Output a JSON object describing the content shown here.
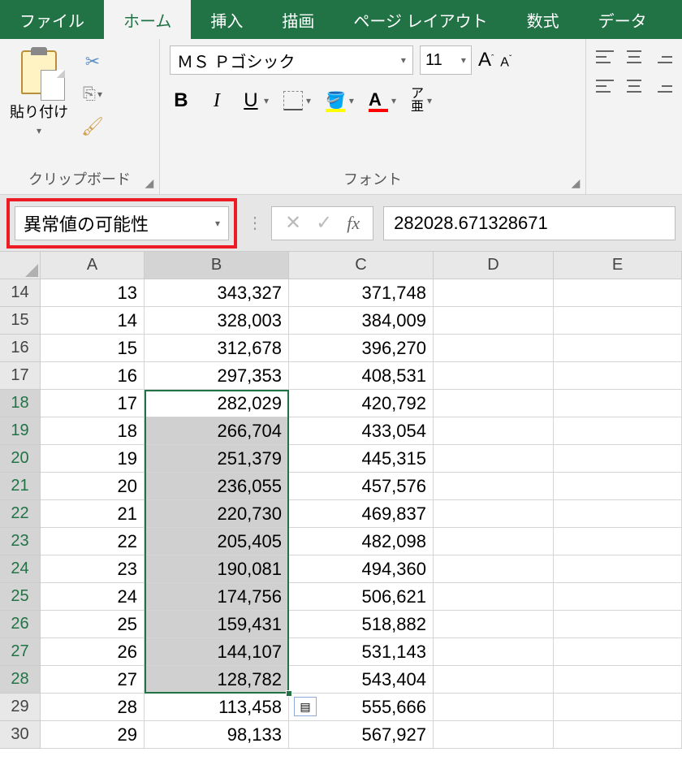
{
  "tabs": {
    "file": "ファイル",
    "home": "ホーム",
    "insert": "挿入",
    "draw": "描画",
    "pagelayout": "ページ レイアウト",
    "formulas": "数式",
    "data": "データ"
  },
  "ribbon": {
    "clipboard": {
      "paste_label": "貼り付け",
      "group_label": "クリップボード"
    },
    "font": {
      "name": "ＭＳ Ｐゴシック",
      "size": "11",
      "group_label": "フォント",
      "bold": "B",
      "italic": "I",
      "underline": "U",
      "ruby_top": "ア",
      "ruby_bot": "亜"
    }
  },
  "namebox": "異常値の可能性",
  "formula_value": "282028.671328671",
  "columns": [
    "A",
    "B",
    "C",
    "D",
    "E"
  ],
  "rows": [
    {
      "n": "14",
      "a": "13",
      "b": "343,327",
      "c": "371,748",
      "sel": false
    },
    {
      "n": "15",
      "a": "14",
      "b": "328,003",
      "c": "384,009",
      "sel": false
    },
    {
      "n": "16",
      "a": "15",
      "b": "312,678",
      "c": "396,270",
      "sel": false
    },
    {
      "n": "17",
      "a": "16",
      "b": "297,353",
      "c": "408,531",
      "sel": false
    },
    {
      "n": "18",
      "a": "17",
      "b": "282,029",
      "c": "420,792",
      "sel": true,
      "active": true
    },
    {
      "n": "19",
      "a": "18",
      "b": "266,704",
      "c": "433,054",
      "sel": true
    },
    {
      "n": "20",
      "a": "19",
      "b": "251,379",
      "c": "445,315",
      "sel": true
    },
    {
      "n": "21",
      "a": "20",
      "b": "236,055",
      "c": "457,576",
      "sel": true
    },
    {
      "n": "22",
      "a": "21",
      "b": "220,730",
      "c": "469,837",
      "sel": true
    },
    {
      "n": "23",
      "a": "22",
      "b": "205,405",
      "c": "482,098",
      "sel": true
    },
    {
      "n": "24",
      "a": "23",
      "b": "190,081",
      "c": "494,360",
      "sel": true
    },
    {
      "n": "25",
      "a": "24",
      "b": "174,756",
      "c": "506,621",
      "sel": true
    },
    {
      "n": "26",
      "a": "25",
      "b": "159,431",
      "c": "518,882",
      "sel": true
    },
    {
      "n": "27",
      "a": "26",
      "b": "144,107",
      "c": "531,143",
      "sel": true
    },
    {
      "n": "28",
      "a": "27",
      "b": "128,782",
      "c": "543,404",
      "sel": true
    },
    {
      "n": "29",
      "a": "28",
      "b": "113,458",
      "c": "555,666",
      "sel": false
    },
    {
      "n": "30",
      "a": "29",
      "b": "98,133",
      "c": "567,927",
      "sel": false
    }
  ]
}
